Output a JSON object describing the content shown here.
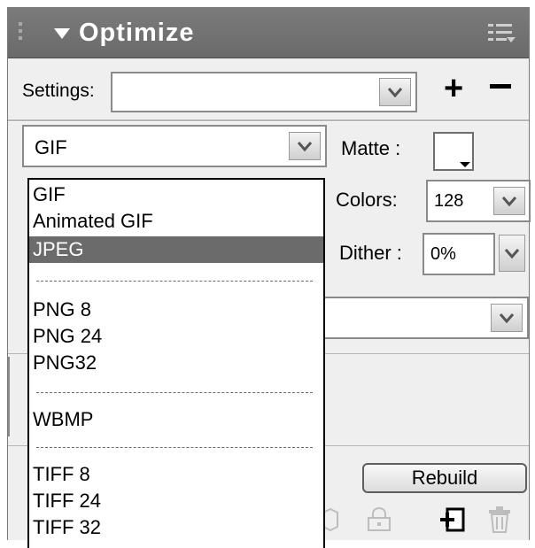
{
  "panel": {
    "title": "Optimize",
    "collapse_icon": "triangle-down-icon",
    "menu_icon": "panel-options-icon"
  },
  "settings": {
    "label": "Settings:",
    "value": "",
    "add_icon": "plus-icon",
    "remove_icon": "minus-icon"
  },
  "format": {
    "value": "GIF",
    "options": [
      {
        "label": "GIF",
        "selected": false
      },
      {
        "label": "Animated GIF",
        "selected": false
      },
      {
        "label": "JPEG",
        "selected": true
      },
      {
        "label": "PNG 8",
        "selected": false
      },
      {
        "label": "PNG 24",
        "selected": false
      },
      {
        "label": "PNG32",
        "selected": false
      },
      {
        "label": "WBMP",
        "selected": false
      },
      {
        "label": "TIFF 8",
        "selected": false
      },
      {
        "label": "TIFF 24",
        "selected": false
      },
      {
        "label": "TIFF 32",
        "selected": false
      }
    ]
  },
  "matte": {
    "label": "Matte :",
    "color": "#ffffff"
  },
  "colors": {
    "label": "Colors:",
    "value": "128"
  },
  "dither": {
    "label": "Dither :",
    "value": "0%"
  },
  "palette_select": {
    "value": ""
  },
  "rebuild": {
    "label": "Rebuild"
  },
  "bottom_icons": [
    "cube-icon",
    "lock-icon",
    "add-color-icon",
    "trash-icon"
  ],
  "colors_theme": {
    "titlebar": "#737373",
    "panel": "#efefef",
    "selection": "#6b6b6b"
  }
}
